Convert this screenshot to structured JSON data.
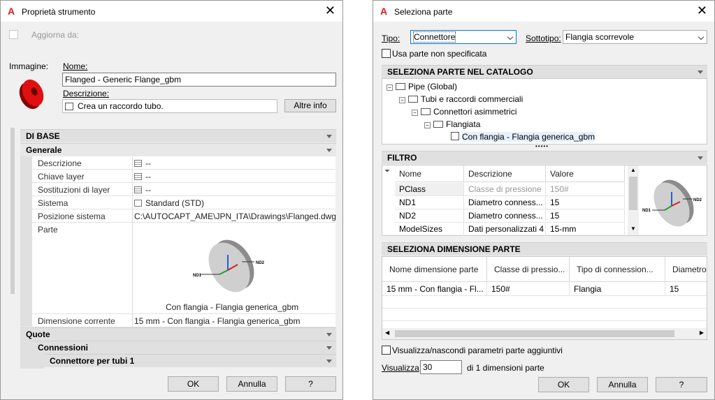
{
  "left": {
    "title": "Proprietà strumento",
    "aggiorna_label": "Aggiorna da:",
    "immagine_label": "Immagine:",
    "nome_label": "Nome:",
    "nome_value": "Flanged - Generic Flange_gbm",
    "descrizione_label": "Descrizione:",
    "descrizione_value": "Crea un raccordo tubo.",
    "altre_info_label": "Altre info",
    "di_base_label": "DI BASE",
    "generale_label": "Generale",
    "properties": [
      {
        "key": "Descrizione",
        "value": "--"
      },
      {
        "key": "Chiave layer",
        "value": "--"
      },
      {
        "key": "Sostituzioni di layer",
        "value": "--"
      },
      {
        "key": "Sistema",
        "value": "Standard (STD)"
      },
      {
        "key": "Posizione sistema",
        "value": "C:\\AUTOCAPT_AME\\JPN_ITA\\Drawings\\Flanged.dwg"
      },
      {
        "key": "Parte",
        "value": ""
      }
    ],
    "parte_caption": "Con flangia - Flangia generica_gbm",
    "nd1": "ND1",
    "nd2": "ND2",
    "dimensione_key": "Dimensione corrente",
    "dimensione_value": "15 mm - Con flangia - Flangia generica_gbm",
    "quote_label": "Quote",
    "connessioni_label": "Connessioni",
    "connettore_label": "Connettore per tubi 1",
    "ok_label": "OK",
    "annulla_label": "Annulla",
    "help_label": "?"
  },
  "right": {
    "title": "Seleziona parte",
    "tipo_label": "Tipo:",
    "tipo_value": "Connettore",
    "sottotipo_label": "Sottotipo:",
    "sottotipo_value": "Flangia scorrevole",
    "usa_parte_label": "Usa parte non specificata",
    "catalogo_header": "SELEZIONA PARTE NEL CATALOGO",
    "tree": [
      "Pipe (Global)",
      "Tubi e raccordi commerciali",
      "Connettori asimmetrici",
      "Flangiata",
      "Con flangia - Flangia generica_gbm"
    ],
    "filtro_header": "FILTRO",
    "filtro_columns": [
      "Nome",
      "Descrizione",
      "Valore"
    ],
    "filtro_rows": [
      [
        "PClass",
        "Classe di pressione",
        "150#"
      ],
      [
        "ND1",
        "Diametro conness...",
        "15"
      ],
      [
        "ND2",
        "Diametro conness...",
        "15"
      ],
      [
        "ModelSizes",
        "Dati personalizzati 4",
        "15-mm"
      ]
    ],
    "nd1": "ND1",
    "nd2": "ND2",
    "dimensione_header": "SELEZIONA DIMENSIONE PARTE",
    "dim_columns": [
      "Nome dimensione parte",
      "Classe di pressio...",
      "Tipo di connession...",
      "Diametro"
    ],
    "dim_rows": [
      [
        "15 mm - Con flangia - Fl...",
        "150#",
        "Flangia",
        "15"
      ]
    ],
    "visualizza_param_label": "Visualizza/nascondi parametri parte aggiuntivi",
    "visualizza_label": "Visualizza",
    "visualizza_value": "30",
    "dimensioni_count_label": "di 1 dimensioni parte",
    "ok_label": "OK",
    "annulla_label": "Annulla",
    "help_label": "?"
  }
}
